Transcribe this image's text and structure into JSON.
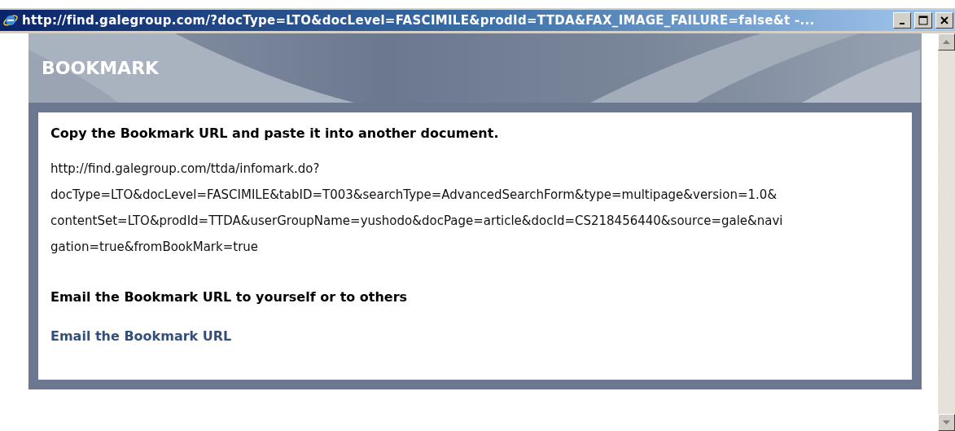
{
  "window": {
    "title": "http://find.galegroup.com/?docType=LTO&docLevel=FASCIMILE&prodId=TTDA&FAX_IMAGE_FAILURE=false&t -..."
  },
  "banner": {
    "title": "BOOKMARK"
  },
  "copy_section": {
    "heading": "Copy the Bookmark URL and paste it into another document.",
    "url_lines": [
      "http://find.galegroup.com/ttda/infomark.do?",
      "docType=LTO&docLevel=FASCIMILE&tabID=T003&searchType=AdvancedSearchForm&type=multipage&version=1.0&",
      "contentSet=LTO&prodId=TTDA&userGroupName=yushodo&docPage=article&docId=CS218456440&source=gale&navi",
      "gation=true&fromBookMark=true"
    ]
  },
  "email_section": {
    "heading": "Email the Bookmark URL to yourself or to others",
    "link": "Email the Bookmark URL"
  }
}
